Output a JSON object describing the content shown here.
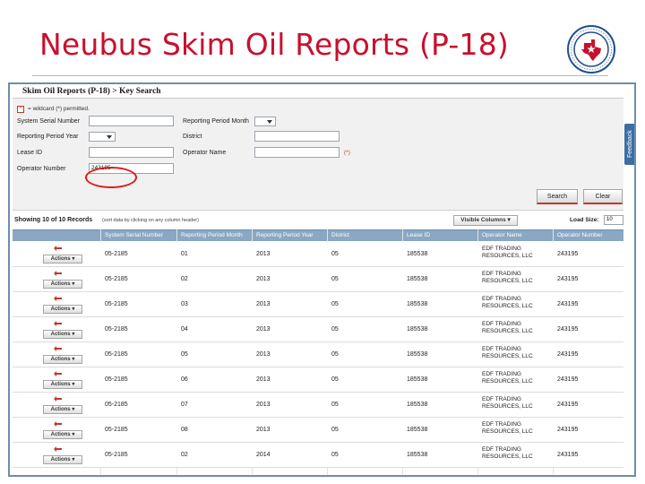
{
  "slide": {
    "title": "Neubus Skim Oil Reports (P-18)"
  },
  "seal_icon": "texas-state-seal-icon",
  "colors": {
    "title": "#c8102e",
    "header_bar": "#8aa7c4",
    "accent_red": "#e01a1a",
    "feedback": "#3c6ea3"
  },
  "app": {
    "breadcrumb": "Skim Oil Reports (P-18) > Key Search",
    "feedback_label": "Feedback",
    "search": {
      "wildcard_note": "= wildcard (*) permitted.",
      "labels": {
        "system_serial_number": "System Serial Number",
        "reporting_period_month": "Reporting Period Month",
        "reporting_period_year": "Reporting Period Year",
        "district": "District",
        "lease_id": "Lease ID",
        "operator_name": "Operator Name",
        "operator_number": "Operator Number"
      },
      "values": {
        "operator_number": "243195"
      },
      "required_mark": "(*)",
      "search_button": "Search",
      "clear_button": "Clear"
    },
    "results": {
      "showing": "Showing 10 of 10 Records",
      "sort_hint": "(sort data by clicking on any column header)",
      "visible_columns": "Visible Columns",
      "load_size_label": "Load Size:",
      "load_size_value": "10",
      "columns": [
        "System Serial Number",
        "Reporting Period Month",
        "Reporting Period Year",
        "District",
        "Lease ID",
        "Operator Name",
        "Operator Number"
      ],
      "actions_label": "Actions",
      "rows": [
        {
          "serial": "05-2185",
          "month": "01",
          "year": "2013",
          "district": "05",
          "lease": "185538",
          "operator": "EDF TRADING RESOURCES, LLC",
          "opnum": "243195"
        },
        {
          "serial": "05-2185",
          "month": "02",
          "year": "2013",
          "district": "05",
          "lease": "185538",
          "operator": "EDF TRADING RESOURCES, LLC",
          "opnum": "243195"
        },
        {
          "serial": "05-2185",
          "month": "03",
          "year": "2013",
          "district": "05",
          "lease": "185538",
          "operator": "EDF TRADING RESOURCES, LLC",
          "opnum": "243195"
        },
        {
          "serial": "05-2185",
          "month": "04",
          "year": "2013",
          "district": "05",
          "lease": "185538",
          "operator": "EDF TRADING RESOURCES, LLC",
          "opnum": "243195"
        },
        {
          "serial": "05-2185",
          "month": "05",
          "year": "2013",
          "district": "05",
          "lease": "185538",
          "operator": "EDF TRADING RESOURCES, LLC",
          "opnum": "243195"
        },
        {
          "serial": "05-2185",
          "month": "06",
          "year": "2013",
          "district": "05",
          "lease": "185538",
          "operator": "EDF TRADING RESOURCES, LLC",
          "opnum": "243195"
        },
        {
          "serial": "05-2185",
          "month": "07",
          "year": "2013",
          "district": "05",
          "lease": "185538",
          "operator": "EDF TRADING RESOURCES, LLC",
          "opnum": "243195"
        },
        {
          "serial": "05-2185",
          "month": "08",
          "year": "2013",
          "district": "05",
          "lease": "185538",
          "operator": "EDF TRADING RESOURCES, LLC",
          "opnum": "243195"
        },
        {
          "serial": "05-2185",
          "month": "02",
          "year": "2014",
          "district": "05",
          "lease": "185538",
          "operator": "EDF TRADING RESOURCES, LLC",
          "opnum": "243195"
        }
      ]
    }
  }
}
